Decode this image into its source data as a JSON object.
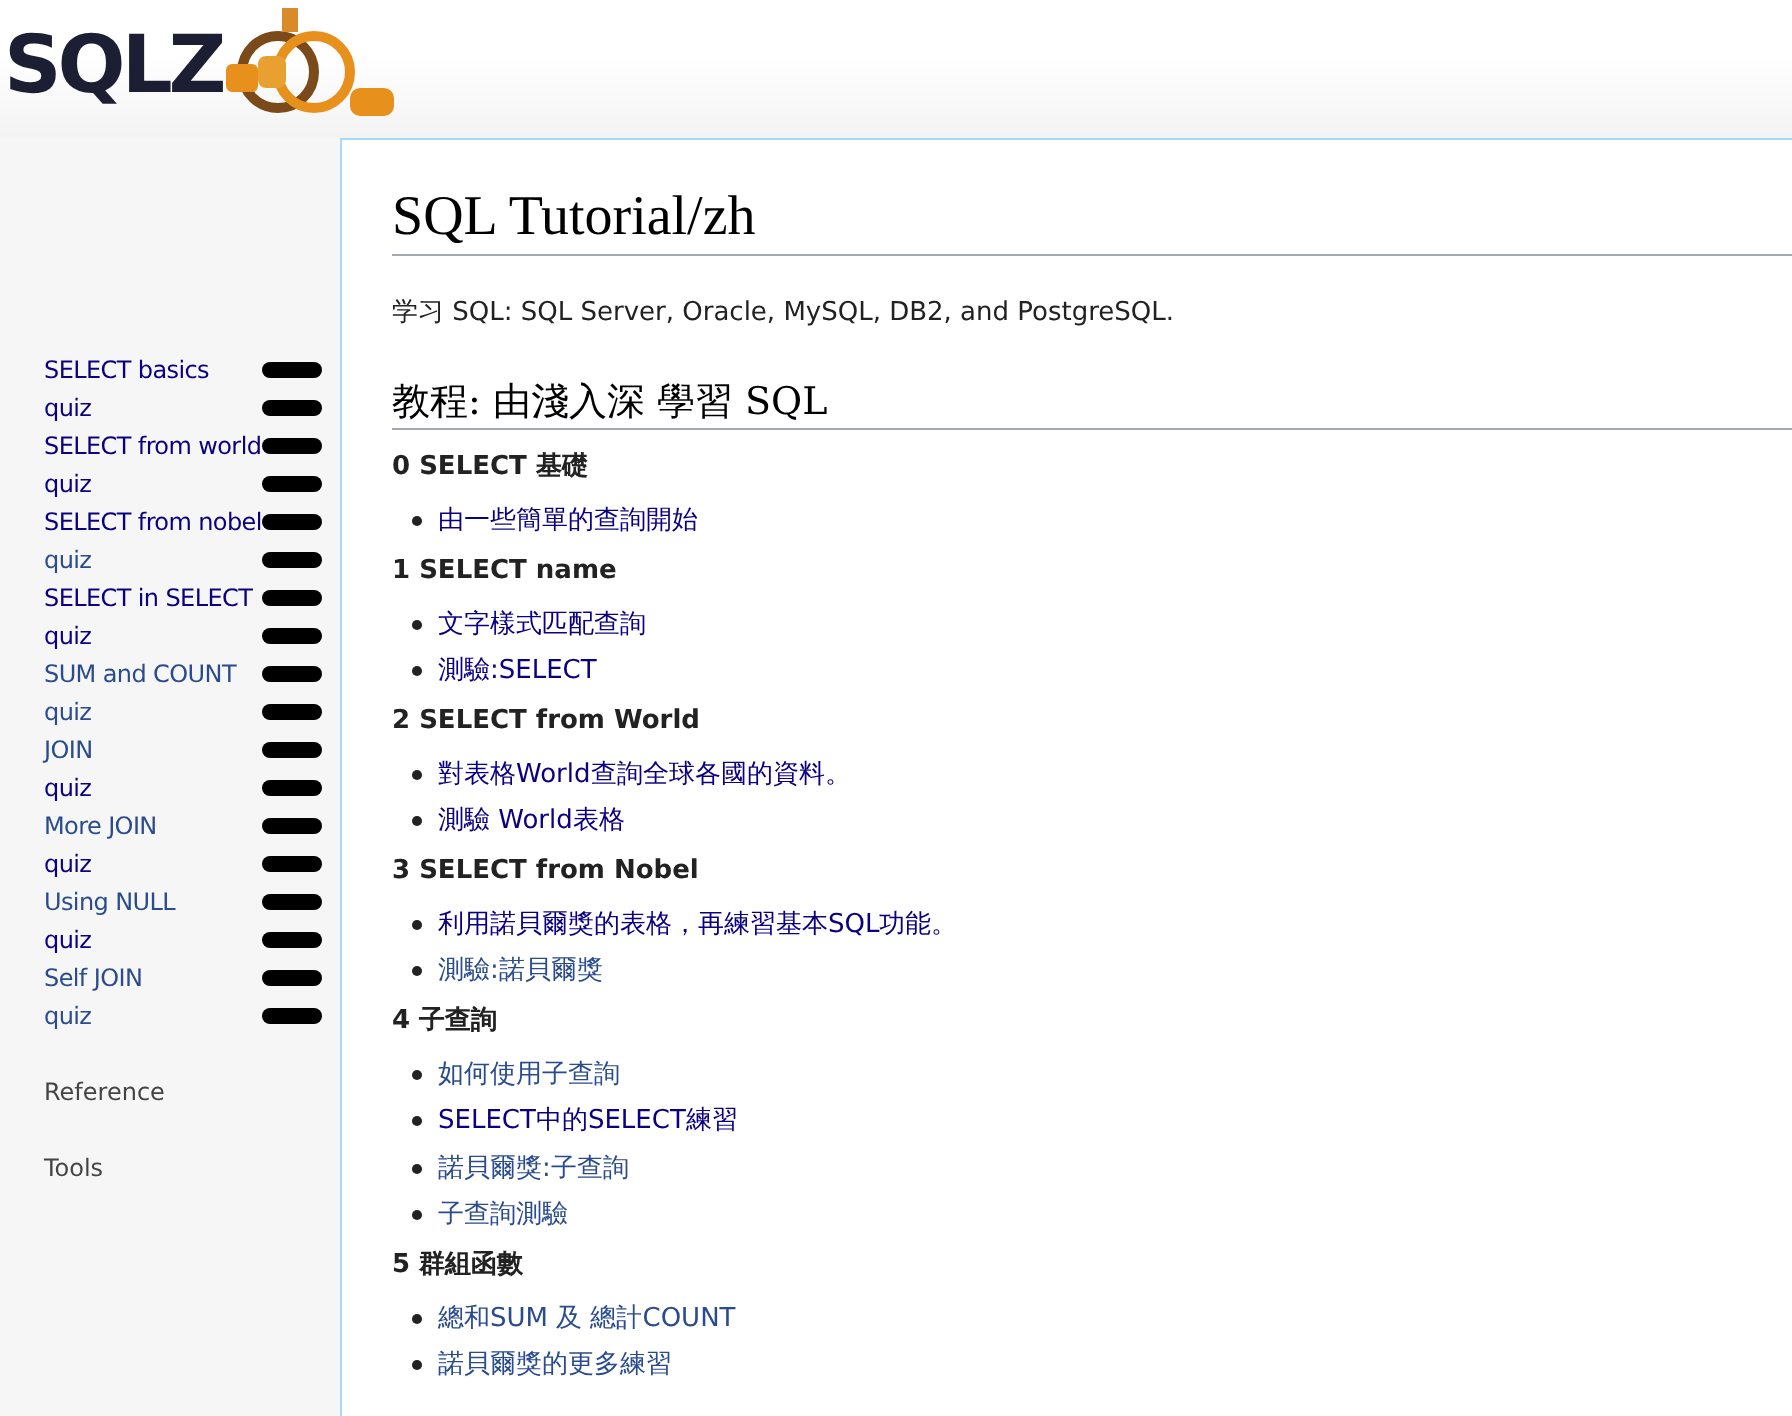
{
  "logo": {
    "text": "SQLZ"
  },
  "sidebar": {
    "items": [
      {
        "label": "SELECT basics",
        "visited": true
      },
      {
        "label": "quiz",
        "visited": true
      },
      {
        "label": "SELECT from world",
        "visited": true
      },
      {
        "label": "quiz",
        "visited": true
      },
      {
        "label": "SELECT from nobel",
        "visited": true
      },
      {
        "label": "quiz",
        "visited": false
      },
      {
        "label": "SELECT in SELECT",
        "visited": true
      },
      {
        "label": "quiz",
        "visited": true
      },
      {
        "label": "SUM and COUNT",
        "visited": false
      },
      {
        "label": "quiz",
        "visited": false
      },
      {
        "label": "JOIN",
        "visited": false
      },
      {
        "label": "quiz",
        "visited": true
      },
      {
        "label": "More JOIN",
        "visited": false
      },
      {
        "label": "quiz",
        "visited": true
      },
      {
        "label": "Using NULL",
        "visited": false
      },
      {
        "label": "quiz",
        "visited": true
      },
      {
        "label": "Self JOIN",
        "visited": false
      },
      {
        "label": "quiz",
        "visited": false
      }
    ],
    "sections": [
      "Reference",
      "Tools"
    ]
  },
  "content": {
    "title": "SQL Tutorial/zh",
    "intro": "学习 SQL: SQL Server, Oracle, MySQL, DB2, and PostgreSQL.",
    "heading": "教程: 由淺入深 學習 SQL",
    "sections": [
      {
        "title": "0 SELECT 基礎",
        "links": [
          {
            "label": "由一些簡單的查詢開始",
            "visited": true
          }
        ]
      },
      {
        "title": "1 SELECT name",
        "links": [
          {
            "label": "文字樣式匹配查詢",
            "visited": true
          },
          {
            "label": "測驗:SELECT",
            "visited": true
          }
        ]
      },
      {
        "title": "2 SELECT from World",
        "links": [
          {
            "label": "對表格World查詢全球各國的資料。",
            "visited": true
          },
          {
            "label": "測驗 World表格",
            "visited": true
          }
        ]
      },
      {
        "title": "3 SELECT from Nobel",
        "links": [
          {
            "label": "利用諾貝爾獎的表格，再練習基本SQL功能。",
            "visited": true
          },
          {
            "label": "測驗:諾貝爾獎",
            "visited": false
          }
        ]
      },
      {
        "title": "4 子查詢",
        "links": [
          {
            "label": "如何使用子查詢",
            "visited": false
          },
          {
            "label": "SELECT中的SELECT練習",
            "visited": true
          },
          {
            "label": "諾貝爾獎:子查詢",
            "visited": false
          },
          {
            "label": "子查詢測驗",
            "visited": false
          }
        ]
      },
      {
        "title": "5 群組函數",
        "links": [
          {
            "label": "總和SUM 及 總計COUNT",
            "visited": false
          },
          {
            "label": "諾貝爾獎的更多練習",
            "visited": false
          }
        ]
      }
    ]
  }
}
